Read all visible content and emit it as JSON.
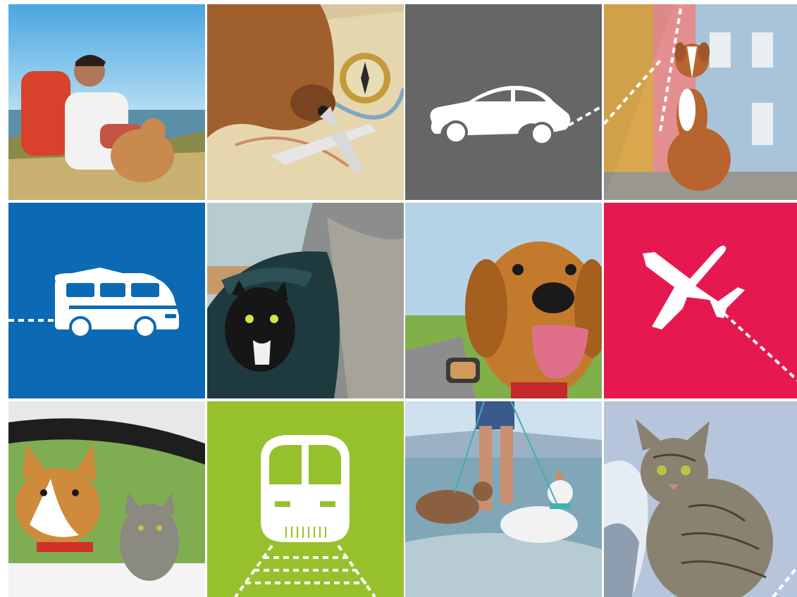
{
  "grid": {
    "rows": 3,
    "columns": 4,
    "tiles": [
      {
        "row": 1,
        "col": 1,
        "kind": "photo",
        "subject": "hiker-with-dog"
      },
      {
        "row": 1,
        "col": 2,
        "kind": "photo",
        "subject": "dog-with-map"
      },
      {
        "row": 1,
        "col": 3,
        "kind": "icon",
        "icon": "car-icon",
        "color": "#666666"
      },
      {
        "row": 1,
        "col": 4,
        "kind": "photo",
        "subject": "dog-on-street"
      },
      {
        "row": 2,
        "col": 1,
        "kind": "icon",
        "icon": "van-icon",
        "color": "#0b6ab3"
      },
      {
        "row": 2,
        "col": 2,
        "kind": "photo",
        "subject": "cat-in-backpack"
      },
      {
        "row": 2,
        "col": 3,
        "kind": "photo",
        "subject": "golden-retriever-in-car"
      },
      {
        "row": 2,
        "col": 4,
        "kind": "icon",
        "icon": "airplane-icon",
        "color": "#e5194f"
      },
      {
        "row": 3,
        "col": 1,
        "kind": "photo",
        "subject": "corgi-and-cat-in-car-window"
      },
      {
        "row": 3,
        "col": 2,
        "kind": "icon",
        "icon": "train-icon",
        "color": "#96c12d"
      },
      {
        "row": 3,
        "col": 3,
        "kind": "photo",
        "subject": "dogs-on-beach"
      },
      {
        "row": 3,
        "col": 4,
        "kind": "photo",
        "subject": "tabby-cat-in-snow"
      }
    ]
  }
}
